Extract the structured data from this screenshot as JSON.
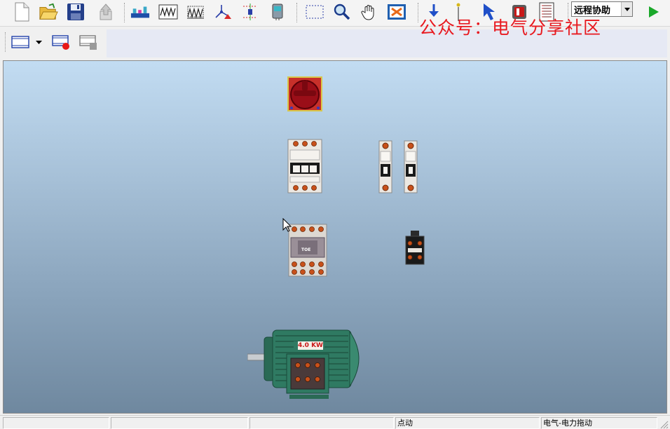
{
  "toolbar": {
    "remote_select_value": "远程协助"
  },
  "watermark": "公众号：电气分享社区",
  "canvas": {
    "motor_label": "4.0 KW",
    "contactor_label": "TOE"
  },
  "status": {
    "p1": "",
    "p2": "",
    "p3": "",
    "p4": "点动",
    "p5": "电气-电力拖动"
  },
  "colors": {
    "accent_red": "#e8191f",
    "motor_green": "#2f7a62",
    "switch_red": "#b01020",
    "breaker_gray": "#e4e0dc"
  }
}
